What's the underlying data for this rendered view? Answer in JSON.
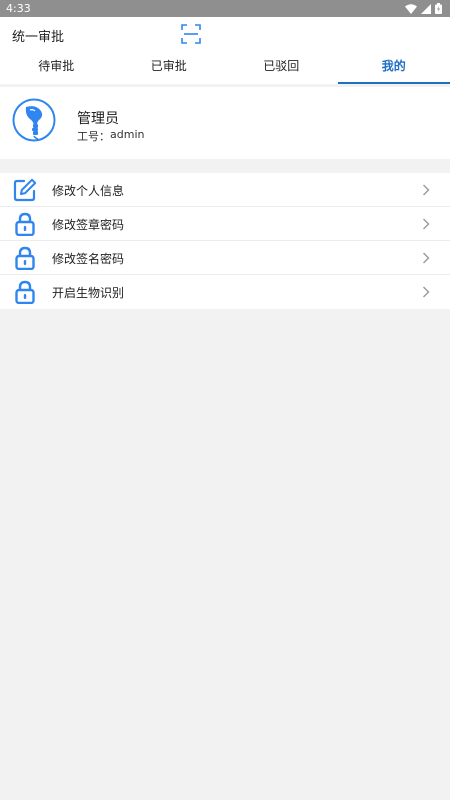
{
  "status_bar": {
    "time": "4:33"
  },
  "app_bar": {
    "title": "统一审批"
  },
  "tabs": [
    {
      "label": "待审批",
      "active": false
    },
    {
      "label": "已审批",
      "active": false
    },
    {
      "label": "已驳回",
      "active": false
    },
    {
      "label": "我的",
      "active": true
    }
  ],
  "profile": {
    "name": "管理员",
    "id_label": "工号：",
    "id_value": "admin"
  },
  "menu": [
    {
      "label": "修改个人信息",
      "icon": "edit-icon"
    },
    {
      "label": "修改签章密码",
      "icon": "lock-icon"
    },
    {
      "label": "修改签名密码",
      "icon": "lock-icon"
    },
    {
      "label": "开启生物识别",
      "icon": "lock-icon"
    }
  ],
  "colors": {
    "accent": "#1f6fc5",
    "icon_blue": "#2f86f0",
    "background": "#f2f2f2"
  }
}
